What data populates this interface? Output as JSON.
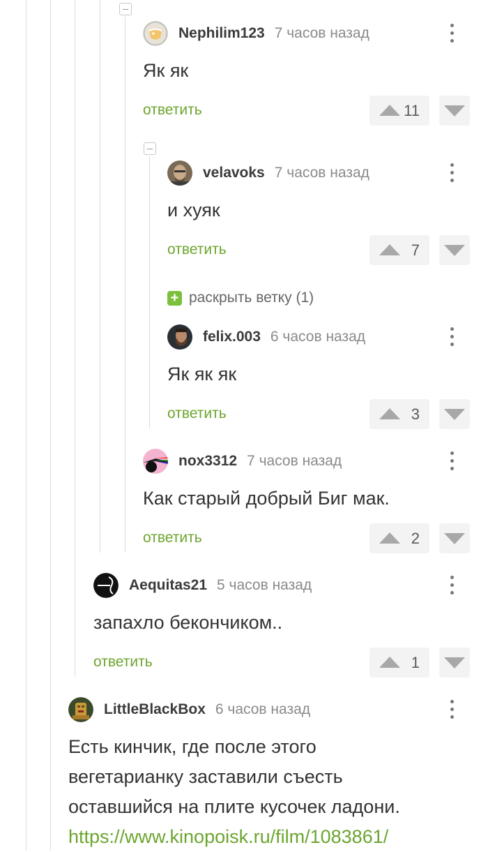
{
  "comments": [
    {
      "author": "Nephilim123",
      "time": "7 часов назад",
      "text": "Як як",
      "reply": "ответить",
      "score": "11",
      "avatar": "wine-glass-avatar"
    },
    {
      "author": "velavoks",
      "time": "7 часов назад",
      "text": "и хуяк",
      "reply": "ответить",
      "score": "7",
      "avatar": "bald-man-avatar"
    },
    {
      "author": "felix.003",
      "time": "6 часов назад",
      "text": "Як як як",
      "reply": "ответить",
      "score": "3",
      "avatar": "bearded-man-avatar"
    },
    {
      "author": "nox3312",
      "time": "7 часов назад",
      "text": "Как старый добрый Биг мак.",
      "reply": "ответить",
      "score": "2",
      "avatar": "prism-avatar"
    },
    {
      "author": "Aequitas21",
      "time": "5 часов назад",
      "text": "запахло бекончиком..",
      "reply": "ответить",
      "score": "1",
      "avatar": "aequitas-logo-avatar"
    },
    {
      "author": "LittleBlackBox",
      "time": "6 часов назад",
      "lines": [
        "Есть кинчик, где после этого",
        "вегетарианку заставили съесть",
        "оставшийся на плите кусочек ладони."
      ],
      "link": "https://www.kinopoisk.ru/film/1083861/",
      "avatar": "golden-idol-avatar"
    }
  ],
  "expand_branch": {
    "label": "раскрыть ветку (1)",
    "icon": "plus-icon"
  },
  "colors": {
    "accent": "#6ca52e",
    "expand": "#7bbf3c",
    "thread_line": "#dcdcdc",
    "text": "#333333",
    "muted": "#8a8a8a"
  }
}
